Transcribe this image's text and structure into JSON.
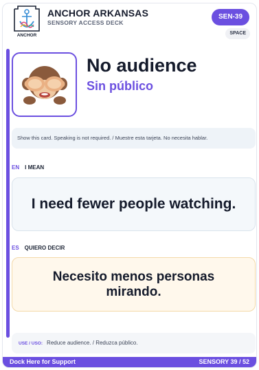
{
  "header": {
    "logo_text": "ANCHOR",
    "title": "ANCHOR ARKANSAS",
    "subtitle": "SENSORY ACCESS DECK",
    "code": "SEN-39",
    "category": "SPACE"
  },
  "card": {
    "icon": "see-no-evil-monkey-emoji",
    "title": "No audience",
    "subtitle": "Sin público",
    "instruction": "Show this card. Speaking is not required. / Muestre esta tarjeta. No necesita hablar."
  },
  "english": {
    "code": "EN",
    "label": "I MEAN",
    "phrase": "I need fewer people watching."
  },
  "spanish": {
    "code": "ES",
    "label": "QUIERO DECIR",
    "phrase": "Necesito menos personas mirando."
  },
  "usage": {
    "label": "USE / USO:",
    "text": "Reduce audience. / Reduzca público."
  },
  "footer": {
    "left": "Dock Here for Support",
    "right": "SENSORY 39 / 52"
  },
  "colors": {
    "accent": "#6b4fe0",
    "english_bg": "#f4f8fb",
    "spanish_bg": "#fff8ec"
  }
}
